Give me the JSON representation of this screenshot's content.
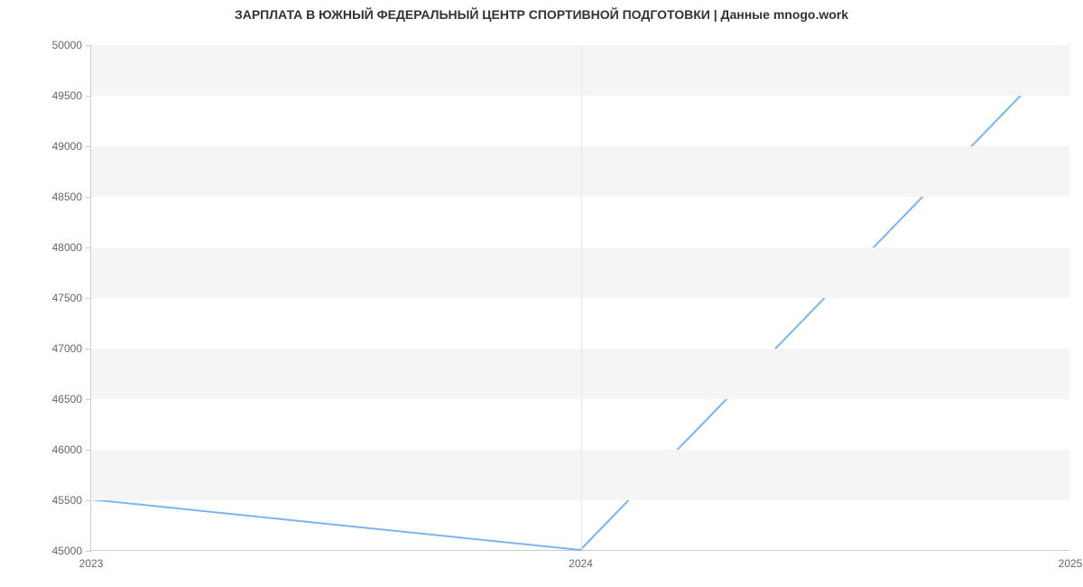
{
  "chart_data": {
    "type": "line",
    "title": "ЗАРПЛАТА В  ЮЖНЫЙ ФЕДЕРАЛЬНЫЙ ЦЕНТР СПОРТИВНОЙ ПОДГОТОВКИ | Данные mnogo.work",
    "x": [
      2023,
      2024,
      2025
    ],
    "values": [
      45500,
      45000,
      50000
    ],
    "x_tick_labels": [
      "2023",
      "2024",
      "2025"
    ],
    "y_ticks": [
      45000,
      45500,
      46000,
      46500,
      47000,
      47500,
      48000,
      48500,
      49000,
      49500,
      50000
    ],
    "xlabel": "",
    "ylabel": "",
    "ylim": [
      45000,
      50000
    ],
    "xlim": [
      2023,
      2025
    ],
    "line_color": "#7cb5ec"
  }
}
